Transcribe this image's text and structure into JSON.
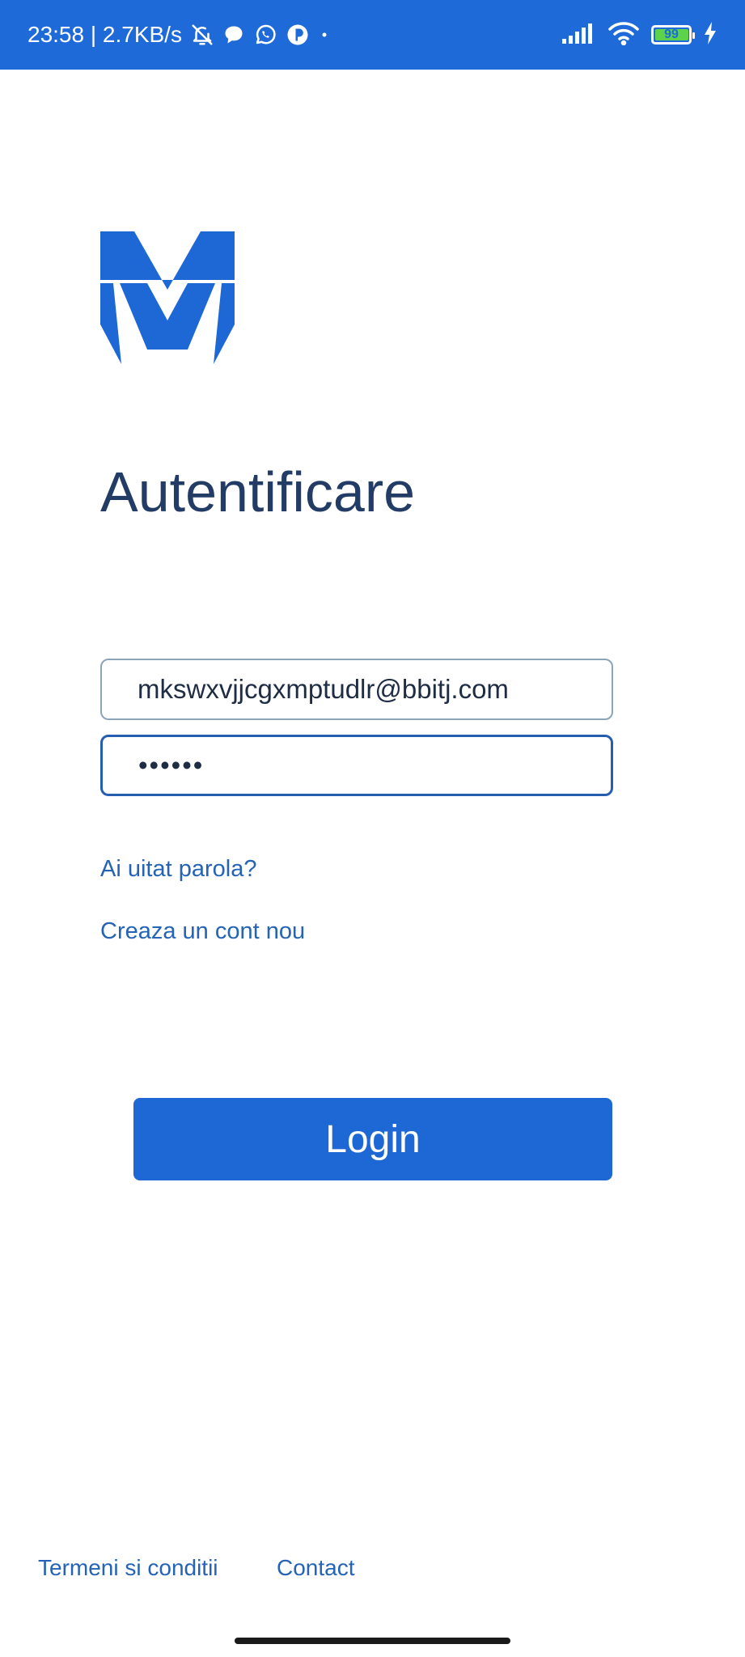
{
  "status_bar": {
    "time_speed": "23:58 | 2.7KB/s",
    "battery_level": "99",
    "background_color": "#1e6ad9",
    "icons": [
      "bell-off-icon",
      "chat-icon",
      "whatsapp-icon",
      "app-icon",
      "dot-icon",
      "signal-icon",
      "wifi-icon",
      "battery-icon",
      "charging-icon"
    ]
  },
  "logo": {
    "icon": "m-logo-icon",
    "color": "#1d68d5"
  },
  "page": {
    "title": "Autentificare"
  },
  "form": {
    "email_value": "mkswxvjjcgxmptudlr@bbitj.com",
    "password_value": "••••••"
  },
  "links": {
    "forgot_password": "Ai uitat parola?",
    "create_account": "Creaza un cont nou"
  },
  "login_button": {
    "label": "Login",
    "color": "#1d68d5"
  },
  "footer": {
    "terms": "Termeni si conditii",
    "contact": "Contact"
  }
}
